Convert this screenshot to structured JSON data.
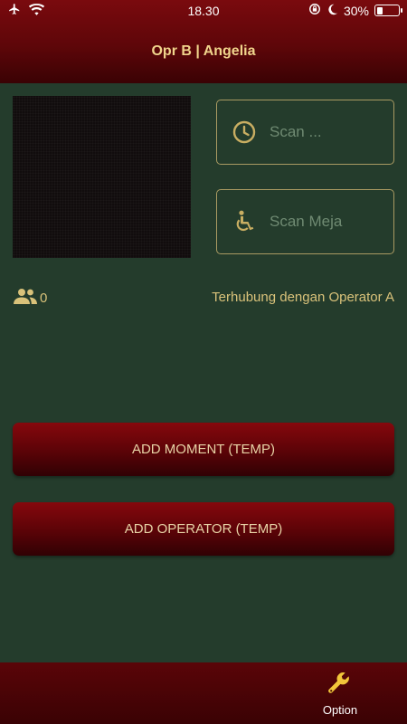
{
  "status_bar": {
    "time": "18.30",
    "battery_percent": "30%",
    "battery_level": 0.3,
    "icons": [
      "airplane-icon",
      "wifi-icon",
      "orientation-lock-icon",
      "moon-icon",
      "battery-icon"
    ]
  },
  "header": {
    "title": "Opr B | Angelia"
  },
  "scan": {
    "scan1_label": "Scan ...",
    "scan1_icon": "clock-icon",
    "scan2_label": "Scan Meja",
    "scan2_icon": "wheelchair-icon"
  },
  "info": {
    "count": "0",
    "count_icon": "people-icon",
    "connection_status": "Terhubung dengan Operator A"
  },
  "actions": {
    "add_moment": "ADD MOMENT (TEMP)",
    "add_operator": "ADD OPERATOR (TEMP)"
  },
  "bottom_nav": {
    "option_label": "Option",
    "option_icon": "wrench-icon"
  },
  "colors": {
    "background": "#243c2c",
    "header_red": "#6b070b",
    "accent_gold": "#d9c27a",
    "scan_border": "#a99a62"
  }
}
